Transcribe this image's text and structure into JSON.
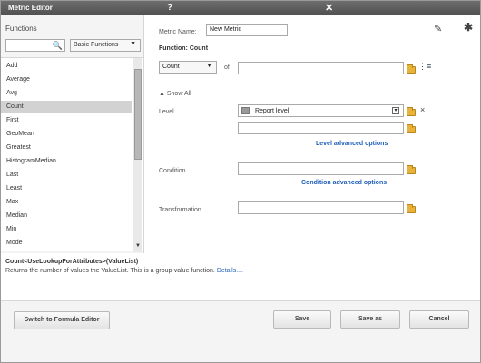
{
  "window": {
    "title": "Metric Editor",
    "help_glyph": "?",
    "close_glyph": "✕"
  },
  "left": {
    "functions_label": "Functions",
    "search": {
      "value": "",
      "placeholder": ""
    },
    "category": "Basic Functions",
    "items": [
      "Add",
      "Average",
      "Avg",
      "Count",
      "First",
      "GeoMean",
      "Greatest",
      "HistogramMedian",
      "Last",
      "Least",
      "Max",
      "Median",
      "Min",
      "Mode"
    ],
    "selected_index": 3
  },
  "editor": {
    "metric_name_label": "Metric Name:",
    "metric_name_value": "New Metric",
    "function_heading": "Function: Count",
    "count_select": "Count",
    "of_label": "of",
    "show_all": "Show All",
    "level_label": "Level",
    "level_value": "Report level",
    "level_advanced": "Level advanced options",
    "condition_label": "Condition",
    "condition_advanced": "Condition advanced options",
    "transformation_label": "Transformation"
  },
  "description": {
    "signature": "Count<UseLookupForAttributes>(ValueList)",
    "text": "Returns the number of values the ValueList. This is a group-value function.",
    "details_link": "Details...."
  },
  "buttons": {
    "switch": "Switch to Formula Editor",
    "save": "Save",
    "save_as": "Save as",
    "cancel": "Cancel"
  },
  "colors": {
    "titlebar": "#5a5a5a",
    "link": "#1f5fb8",
    "folder": "#e8b33a",
    "selected_row": "#d2d2d2"
  }
}
